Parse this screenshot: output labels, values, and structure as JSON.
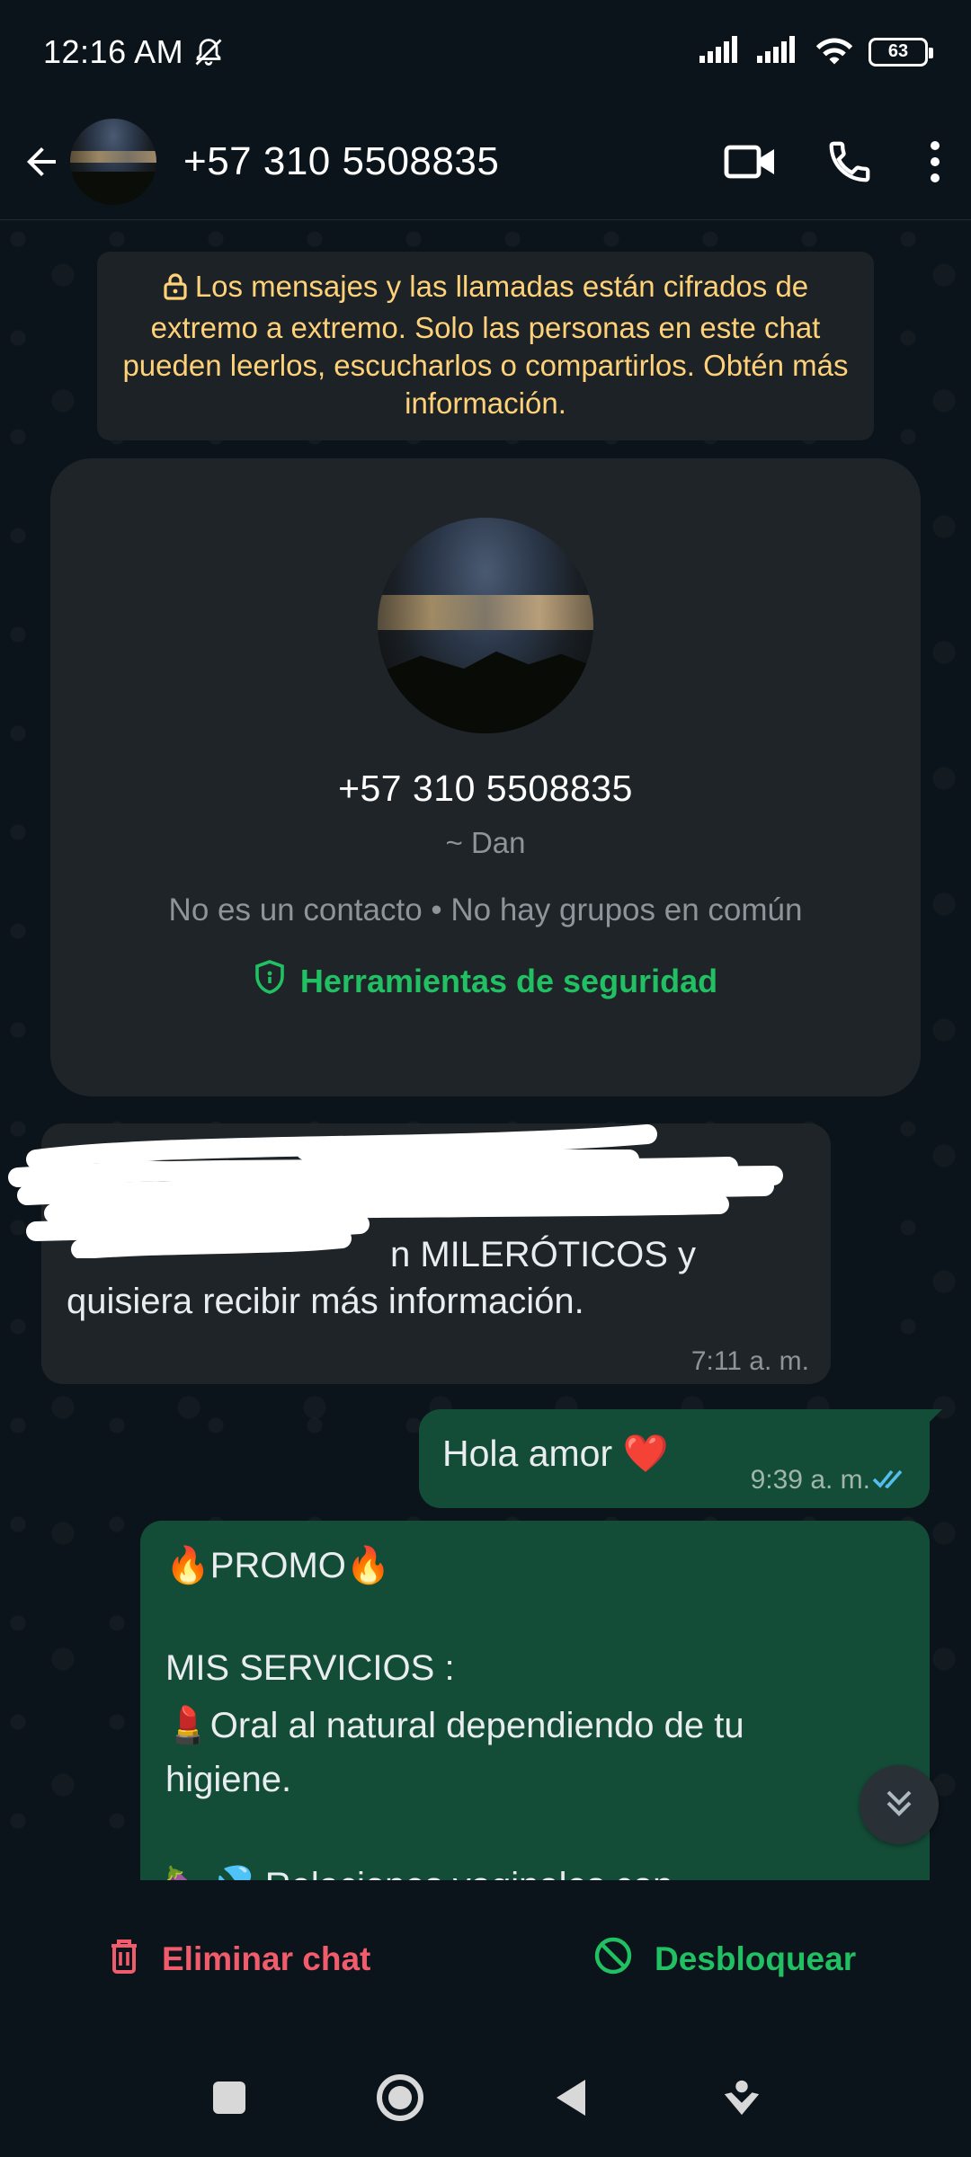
{
  "status_bar": {
    "time": "12:16 AM",
    "battery": "63",
    "icons": [
      "mute-icon",
      "signal-icon",
      "signal-icon",
      "wifi-icon",
      "battery-icon"
    ]
  },
  "header": {
    "title": "+57 310 5508835",
    "icons": [
      "back-arrow-icon",
      "video-call-icon",
      "phone-icon",
      "more-vert-icon"
    ]
  },
  "encryption_notice": {
    "text": "Los mensajes y las llamadas están cifrados de extremo a extremo. Solo las personas en este chat pueden leerlos, escucharlos o compartirlos. Obtén más información."
  },
  "profile_card": {
    "number": "+57 310 5508835",
    "pushname": "~ Dan",
    "meta": "No es un contacto • No hay grupos en común",
    "safety_tools": "Herramientas de seguridad"
  },
  "messages": {
    "incoming_1": {
      "text_line1": "n MILERÓTICOS y",
      "text_line2": "quisiera recibir más información.",
      "time": "7:11 a. m."
    },
    "outgoing_1": {
      "text": "Hola amor ❤️",
      "time": "9:39 a. m."
    },
    "outgoing_2": {
      "line1": "🔥PROMO🔥",
      "line2": "MIS SERVICIOS :",
      "line3": "💄Oral al natural dependiendo de tu",
      "line4": "higiene.",
      "line5": "🍆💦 Relaciones vaginales con"
    }
  },
  "actions": {
    "delete": "Eliminar chat",
    "unblock": "Desbloquear"
  },
  "colors": {
    "background": "#0b141a",
    "bubble_out": "#144d37",
    "bubble_in": "#1f2428",
    "accent_green": "#21c063",
    "danger_red": "#f15c6d",
    "notice_yellow": "#ffd279",
    "read_ticks": "#53bdeb"
  }
}
